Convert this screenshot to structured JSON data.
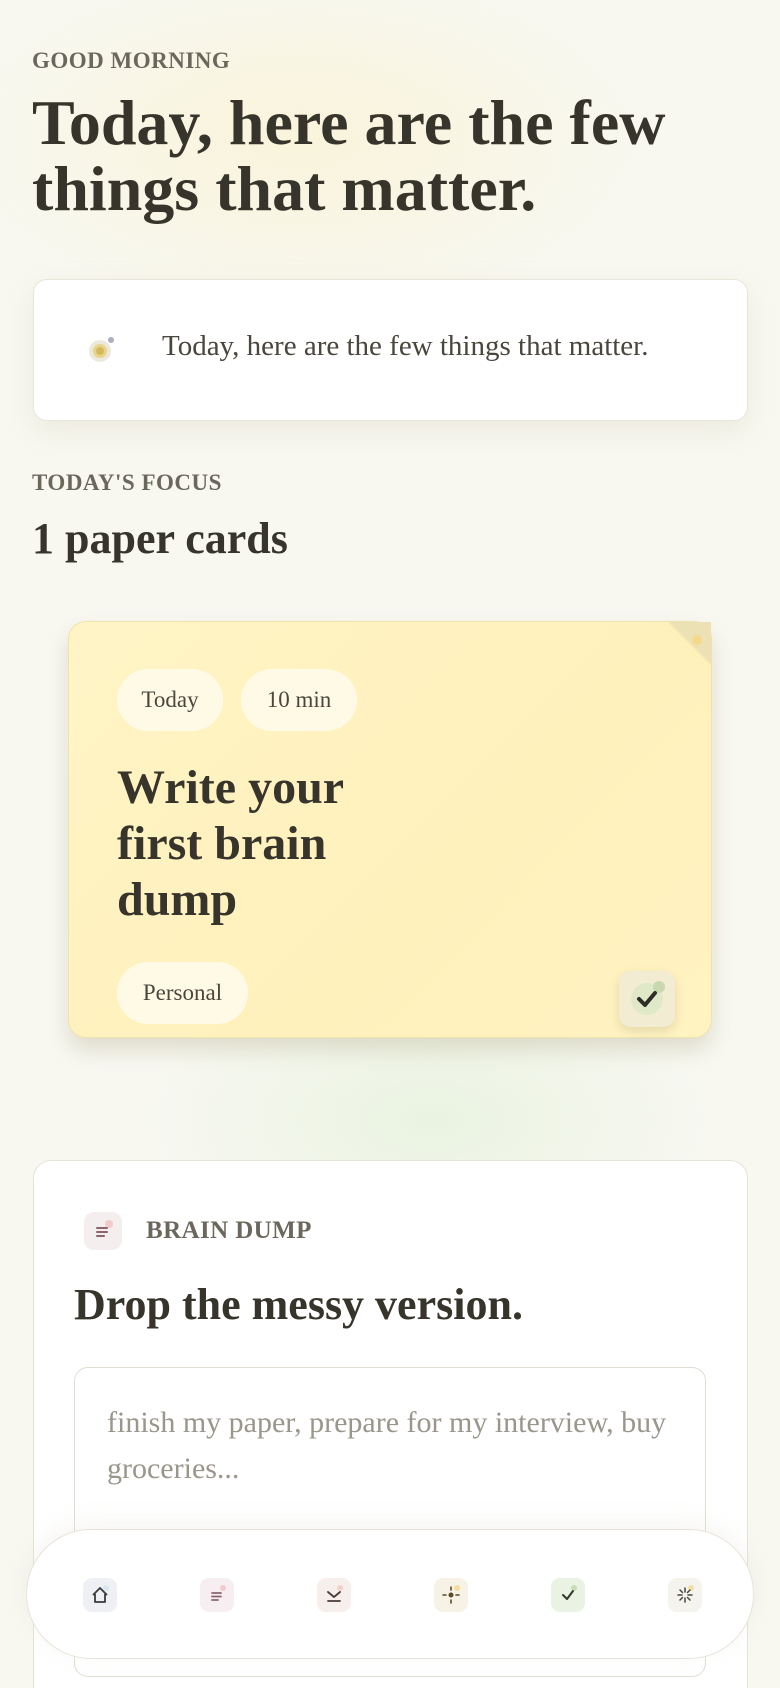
{
  "header": {
    "greeting": "GOOD MORNING",
    "headline": "Today, here are the few things that matter."
  },
  "quote_card": {
    "icon": "sun-dial-icon",
    "text": "Today, here are the few things that matter."
  },
  "focus": {
    "kicker": "TODAY'S FOCUS",
    "title": "1 paper cards"
  },
  "paper_card": {
    "color": "#fff2bf",
    "chips": {
      "when": "Today",
      "duration": "10 min",
      "category": "Personal"
    },
    "title": "Write your first brain dump",
    "check_icon": "check-icon"
  },
  "brain_dump": {
    "icon": "notes-icon",
    "kicker": "BRAIN DUMP",
    "title": "Drop the messy version.",
    "input_value": "",
    "placeholder": "finish my paper, prepare for my interview, buy groceries..."
  },
  "bottom_nav": {
    "items": [
      {
        "icon": "home-icon",
        "tint": "#eef0f4"
      },
      {
        "icon": "notes-icon",
        "tint": "#f6eef0"
      },
      {
        "icon": "inbox-icon",
        "tint": "#f6efec"
      },
      {
        "icon": "focus-icon",
        "tint": "#f7f2e6"
      },
      {
        "icon": "done-icon",
        "tint": "#eaf2e4"
      },
      {
        "icon": "sparkle-icon",
        "tint": "#f5f3ee"
      }
    ]
  }
}
